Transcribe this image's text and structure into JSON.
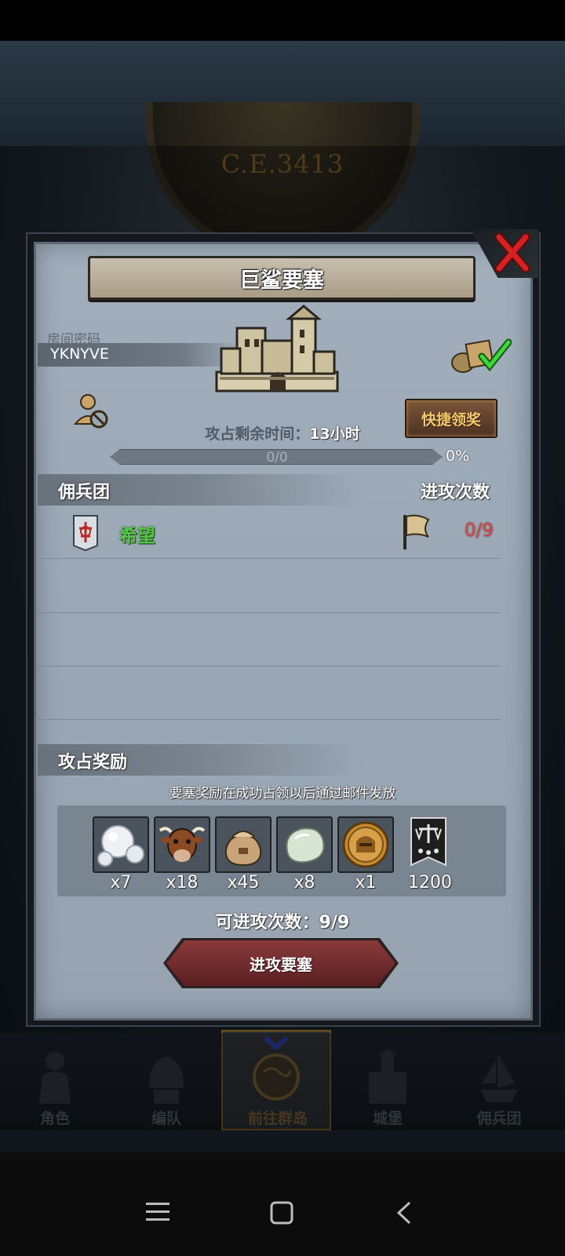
{
  "background": {
    "era_label": "C.E.3413"
  },
  "dialog": {
    "title": "巨鲨要塞",
    "room_password_label": "房间密码",
    "room_code": "YKNYVE",
    "quick_claim_label": "快捷领奖",
    "time_prefix": "攻占剩余时间：",
    "time_value": "13小时",
    "progress": {
      "count_text": "0/0",
      "percent_text": "0%",
      "fraction": 0
    },
    "mercenary_header": "佣兵团",
    "attacks_header": "进攻次数",
    "guilds": [
      {
        "name": "希望",
        "attacks": "0/9"
      }
    ],
    "reward_header": "攻占奖励",
    "reward_note": "要塞奖励在成功占领以后通过邮件发放",
    "rewards": [
      {
        "icon": "pearls-icon",
        "qty": "x7"
      },
      {
        "icon": "cow-icon",
        "qty": "x18"
      },
      {
        "icon": "grain-sack-icon",
        "qty": "x45"
      },
      {
        "icon": "stone-icon",
        "qty": "x8"
      },
      {
        "icon": "knight-coin-icon",
        "qty": "x1"
      },
      {
        "icon": "justice-banner-icon",
        "qty": "1200"
      }
    ],
    "attack_available": "可进攻次数：9/9",
    "attack_button_label": "进攻要塞"
  },
  "bottom_nav": {
    "items": [
      {
        "label": "角色",
        "icon": "knight-icon"
      },
      {
        "label": "编队",
        "icon": "helmet-icon"
      },
      {
        "label": "前往群岛",
        "icon": "globe-icon",
        "active": true
      },
      {
        "label": "城堡",
        "icon": "castle-icon"
      },
      {
        "label": "佣兵团",
        "icon": "ship-icon"
      }
    ]
  },
  "colors": {
    "guild_name": "#56c54a",
    "attack_count": "#d14a4a",
    "quick_claim_text": "#f3c76a",
    "attack_button": "#7a2e30"
  }
}
